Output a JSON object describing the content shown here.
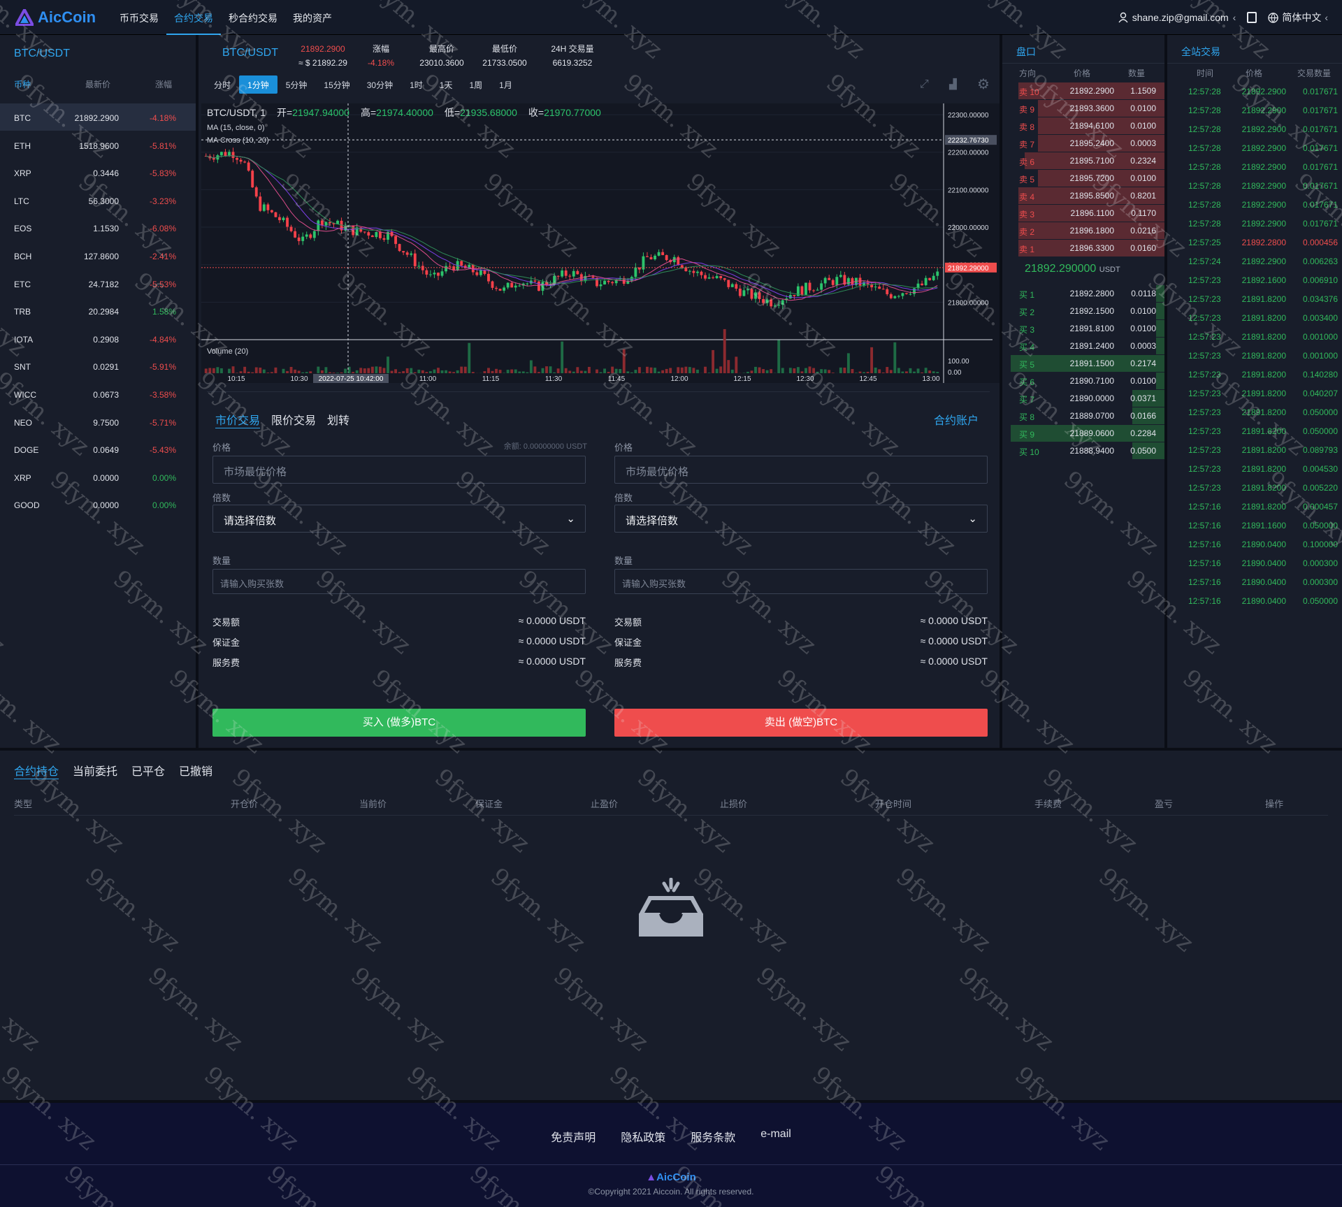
{
  "nav": {
    "brand": "AicCoin",
    "links": [
      "币币交易",
      "合约交易",
      "秒合约交易",
      "我的资产"
    ],
    "active": 1,
    "user": "shane.zip@gmail.com",
    "lang": "简体中文"
  },
  "coins": {
    "title": "BTC/USDT",
    "headers": [
      "币种",
      "最新价",
      "涨幅"
    ],
    "rows": [
      [
        "BTC",
        "21892.2900",
        "-4.18%"
      ],
      [
        "ETH",
        "1518.9600",
        "-5.81%"
      ],
      [
        "XRP",
        "0.3446",
        "-5.83%"
      ],
      [
        "LTC",
        "56.3000",
        "-3.23%"
      ],
      [
        "EOS",
        "1.1530",
        "-6.08%"
      ],
      [
        "BCH",
        "127.8600",
        "-2.41%"
      ],
      [
        "ETC",
        "24.7182",
        "-5.53%"
      ],
      [
        "TRB",
        "20.2984",
        "1.58%"
      ],
      [
        "IOTA",
        "0.2908",
        "-4.84%"
      ],
      [
        "SNT",
        "0.0291",
        "-5.91%"
      ],
      [
        "WICC",
        "0.0673",
        "-3.58%"
      ],
      [
        "NEO",
        "9.7500",
        "-5.71%"
      ],
      [
        "DOGE",
        "0.0649",
        "-5.43%"
      ],
      [
        "XRP",
        "0.0000",
        "0.00%"
      ],
      [
        "GOOD",
        "0.0000",
        "0.00%"
      ]
    ]
  },
  "ticker": {
    "pair": "BTC/USDT",
    "price": "21892.2900",
    "price_usd": "≈ $ 21892.29",
    "change_label": "涨幅",
    "change": "-4.18%",
    "high_label": "最高价",
    "high": "23010.3600",
    "low_label": "最低价",
    "low": "21733.0500",
    "vol_label": "24H 交易量",
    "vol": "6619.3252"
  },
  "timeframes": [
    "分时",
    "1分钟",
    "5分钟",
    "15分钟",
    "30分钟",
    "1时",
    "1天",
    "1周",
    "1月"
  ],
  "tf_active": 1,
  "chart": {
    "legend_symbol": "BTC/USDT, 1",
    "legend_ohlc": [
      [
        "开=",
        "21947.94000"
      ],
      [
        "高=",
        "21974.40000"
      ],
      [
        "低=",
        "21935.68000"
      ],
      [
        "收=",
        "21970.77000"
      ]
    ],
    "ind1": "MA (15, close, 0)",
    "ind2": "MA Cross (10, 20)",
    "vol_label": "Volume (20)",
    "price_ticks": [
      "22300.00000",
      "22200.00000",
      "22100.00000",
      "22000.00000",
      "21900.00000",
      "21800.00000"
    ],
    "crosshair_price": "22232.76730",
    "last_price": "21892.29000",
    "vol_ticks": [
      "100.00",
      "0.00"
    ],
    "time_ticks": [
      "10:15",
      "10:30",
      "11:00",
      "11:15",
      "11:30",
      "11:45",
      "12:00",
      "12:15",
      "12:30",
      "12:45",
      "13:00"
    ],
    "crosshair_time": "2022-07-25 10:42:00"
  },
  "trade": {
    "tabs": [
      "市价交易",
      "限价交易",
      "划转"
    ],
    "account": "合约账户",
    "price_label": "价格",
    "balance": "余额: 0.00000000 USDT",
    "price_ph": "市场最优价格",
    "lev_label": "倍数",
    "lev_ph": "请选择倍数",
    "qty_label": "数量",
    "qty_ph": "请输入购买张数",
    "fees": [
      [
        "交易额",
        "≈ 0.0000 USDT"
      ],
      [
        "保证金",
        "≈ 0.0000 USDT"
      ],
      [
        "服务费",
        "≈ 0.0000 USDT"
      ]
    ],
    "buy": "买入 (做多)BTC",
    "sell": "卖出 (做空)BTC",
    "buy_color": "#31b95c",
    "sell_color": "#ef4d4d"
  },
  "book": {
    "title": "盘口",
    "headers": [
      "方向",
      "价格",
      "数量"
    ],
    "asks": [
      [
        "卖 10",
        "21892.2900",
        "1.1509",
        0.9
      ],
      [
        "卖 9",
        "21893.3600",
        "0.0100",
        0.78
      ],
      [
        "卖 8",
        "21894.6100",
        "0.0100",
        0.78
      ],
      [
        "卖 7",
        "21895.2400",
        "0.0003",
        0.78
      ],
      [
        "卖 6",
        "21895.7100",
        "0.2324",
        0.86
      ],
      [
        "卖 5",
        "21895.7200",
        "0.0100",
        0.78
      ],
      [
        "卖 4",
        "21895.8500",
        "0.8201",
        0.9
      ],
      [
        "卖 3",
        "21896.1100",
        "0.1170",
        0.9
      ],
      [
        "卖 2",
        "21896.1800",
        "0.0216",
        0.9
      ],
      [
        "卖 1",
        "21896.3300",
        "0.0160",
        0.9
      ]
    ],
    "last": "21892.290000",
    "unit": "USDT",
    "bids": [
      [
        "买 1",
        "21892.2800",
        "0.0118",
        0.05
      ],
      [
        "买 2",
        "21892.1500",
        "0.0100",
        0.05
      ],
      [
        "买 3",
        "21891.8100",
        "0.0100",
        0.05
      ],
      [
        "买 4",
        "21891.2400",
        "0.0003",
        0.05
      ],
      [
        "买 5",
        "21891.1500",
        "0.2174",
        0.95
      ],
      [
        "买 6",
        "21890.7100",
        "0.0100",
        0.05
      ],
      [
        "买 7",
        "21890.0000",
        "0.0371",
        0.2
      ],
      [
        "买 8",
        "21889.0700",
        "0.0166",
        0.2
      ],
      [
        "买 9",
        "21889.0600",
        "0.2284",
        0.95
      ],
      [
        "买 10",
        "21888.9400",
        "0.0500",
        0.2
      ]
    ]
  },
  "trades": {
    "title": "全站交易",
    "headers": [
      "时间",
      "价格",
      "交易数量"
    ],
    "rows": [
      [
        "12:57:28",
        "21892.2900",
        "0.017671"
      ],
      [
        "12:57:28",
        "21892.2900",
        "0.017671"
      ],
      [
        "12:57:28",
        "21892.2900",
        "0.017671"
      ],
      [
        "12:57:28",
        "21892.2900",
        "0.017671"
      ],
      [
        "12:57:28",
        "21892.2900",
        "0.017671"
      ],
      [
        "12:57:28",
        "21892.2900",
        "0.017671"
      ],
      [
        "12:57:28",
        "21892.2900",
        "0.017671"
      ],
      [
        "12:57:28",
        "21892.2900",
        "0.017671"
      ],
      [
        "12:57:25",
        "21892.2800",
        "0.000456"
      ],
      [
        "12:57:24",
        "21892.2900",
        "0.006263"
      ],
      [
        "12:57:23",
        "21892.1600",
        "0.006910"
      ],
      [
        "12:57:23",
        "21891.8200",
        "0.034376"
      ],
      [
        "12:57:23",
        "21891.8200",
        "0.003400"
      ],
      [
        "12:57:23",
        "21891.8200",
        "0.001000"
      ],
      [
        "12:57:23",
        "21891.8200",
        "0.001000"
      ],
      [
        "12:57:23",
        "21891.8200",
        "0.140280"
      ],
      [
        "12:57:23",
        "21891.8200",
        "0.040207"
      ],
      [
        "12:57:23",
        "21891.8200",
        "0.050000"
      ],
      [
        "12:57:23",
        "21891.8200",
        "0.050000"
      ],
      [
        "12:57:23",
        "21891.8200",
        "0.089793"
      ],
      [
        "12:57:23",
        "21891.8200",
        "0.004530"
      ],
      [
        "12:57:23",
        "21891.8200",
        "0.005220"
      ],
      [
        "12:57:16",
        "21891.8200",
        "0.000457"
      ],
      [
        "12:57:16",
        "21891.1600",
        "0.050000"
      ],
      [
        "12:57:16",
        "21890.0400",
        "0.100000"
      ],
      [
        "12:57:16",
        "21890.0400",
        "0.000300"
      ],
      [
        "12:57:16",
        "21890.0400",
        "0.000300"
      ],
      [
        "12:57:16",
        "21890.0400",
        "0.050000"
      ]
    ]
  },
  "positions": {
    "tabs": [
      "合约持仓",
      "当前委托",
      "已平仓",
      "已撤销"
    ],
    "headers": [
      "类型",
      "开仓价",
      "当前价",
      "保证金",
      "止盈价",
      "止损价",
      "开仓时间",
      "手续费",
      "盈亏",
      "操作"
    ]
  },
  "footer": {
    "links": [
      "免责声明",
      "隐私政策",
      "服务条款",
      "e-mail"
    ],
    "brand": "AicCoin",
    "copyright": "©Copyright 2021 Aiccoin. All rights reserved."
  },
  "watermark": "9fym. xyz"
}
